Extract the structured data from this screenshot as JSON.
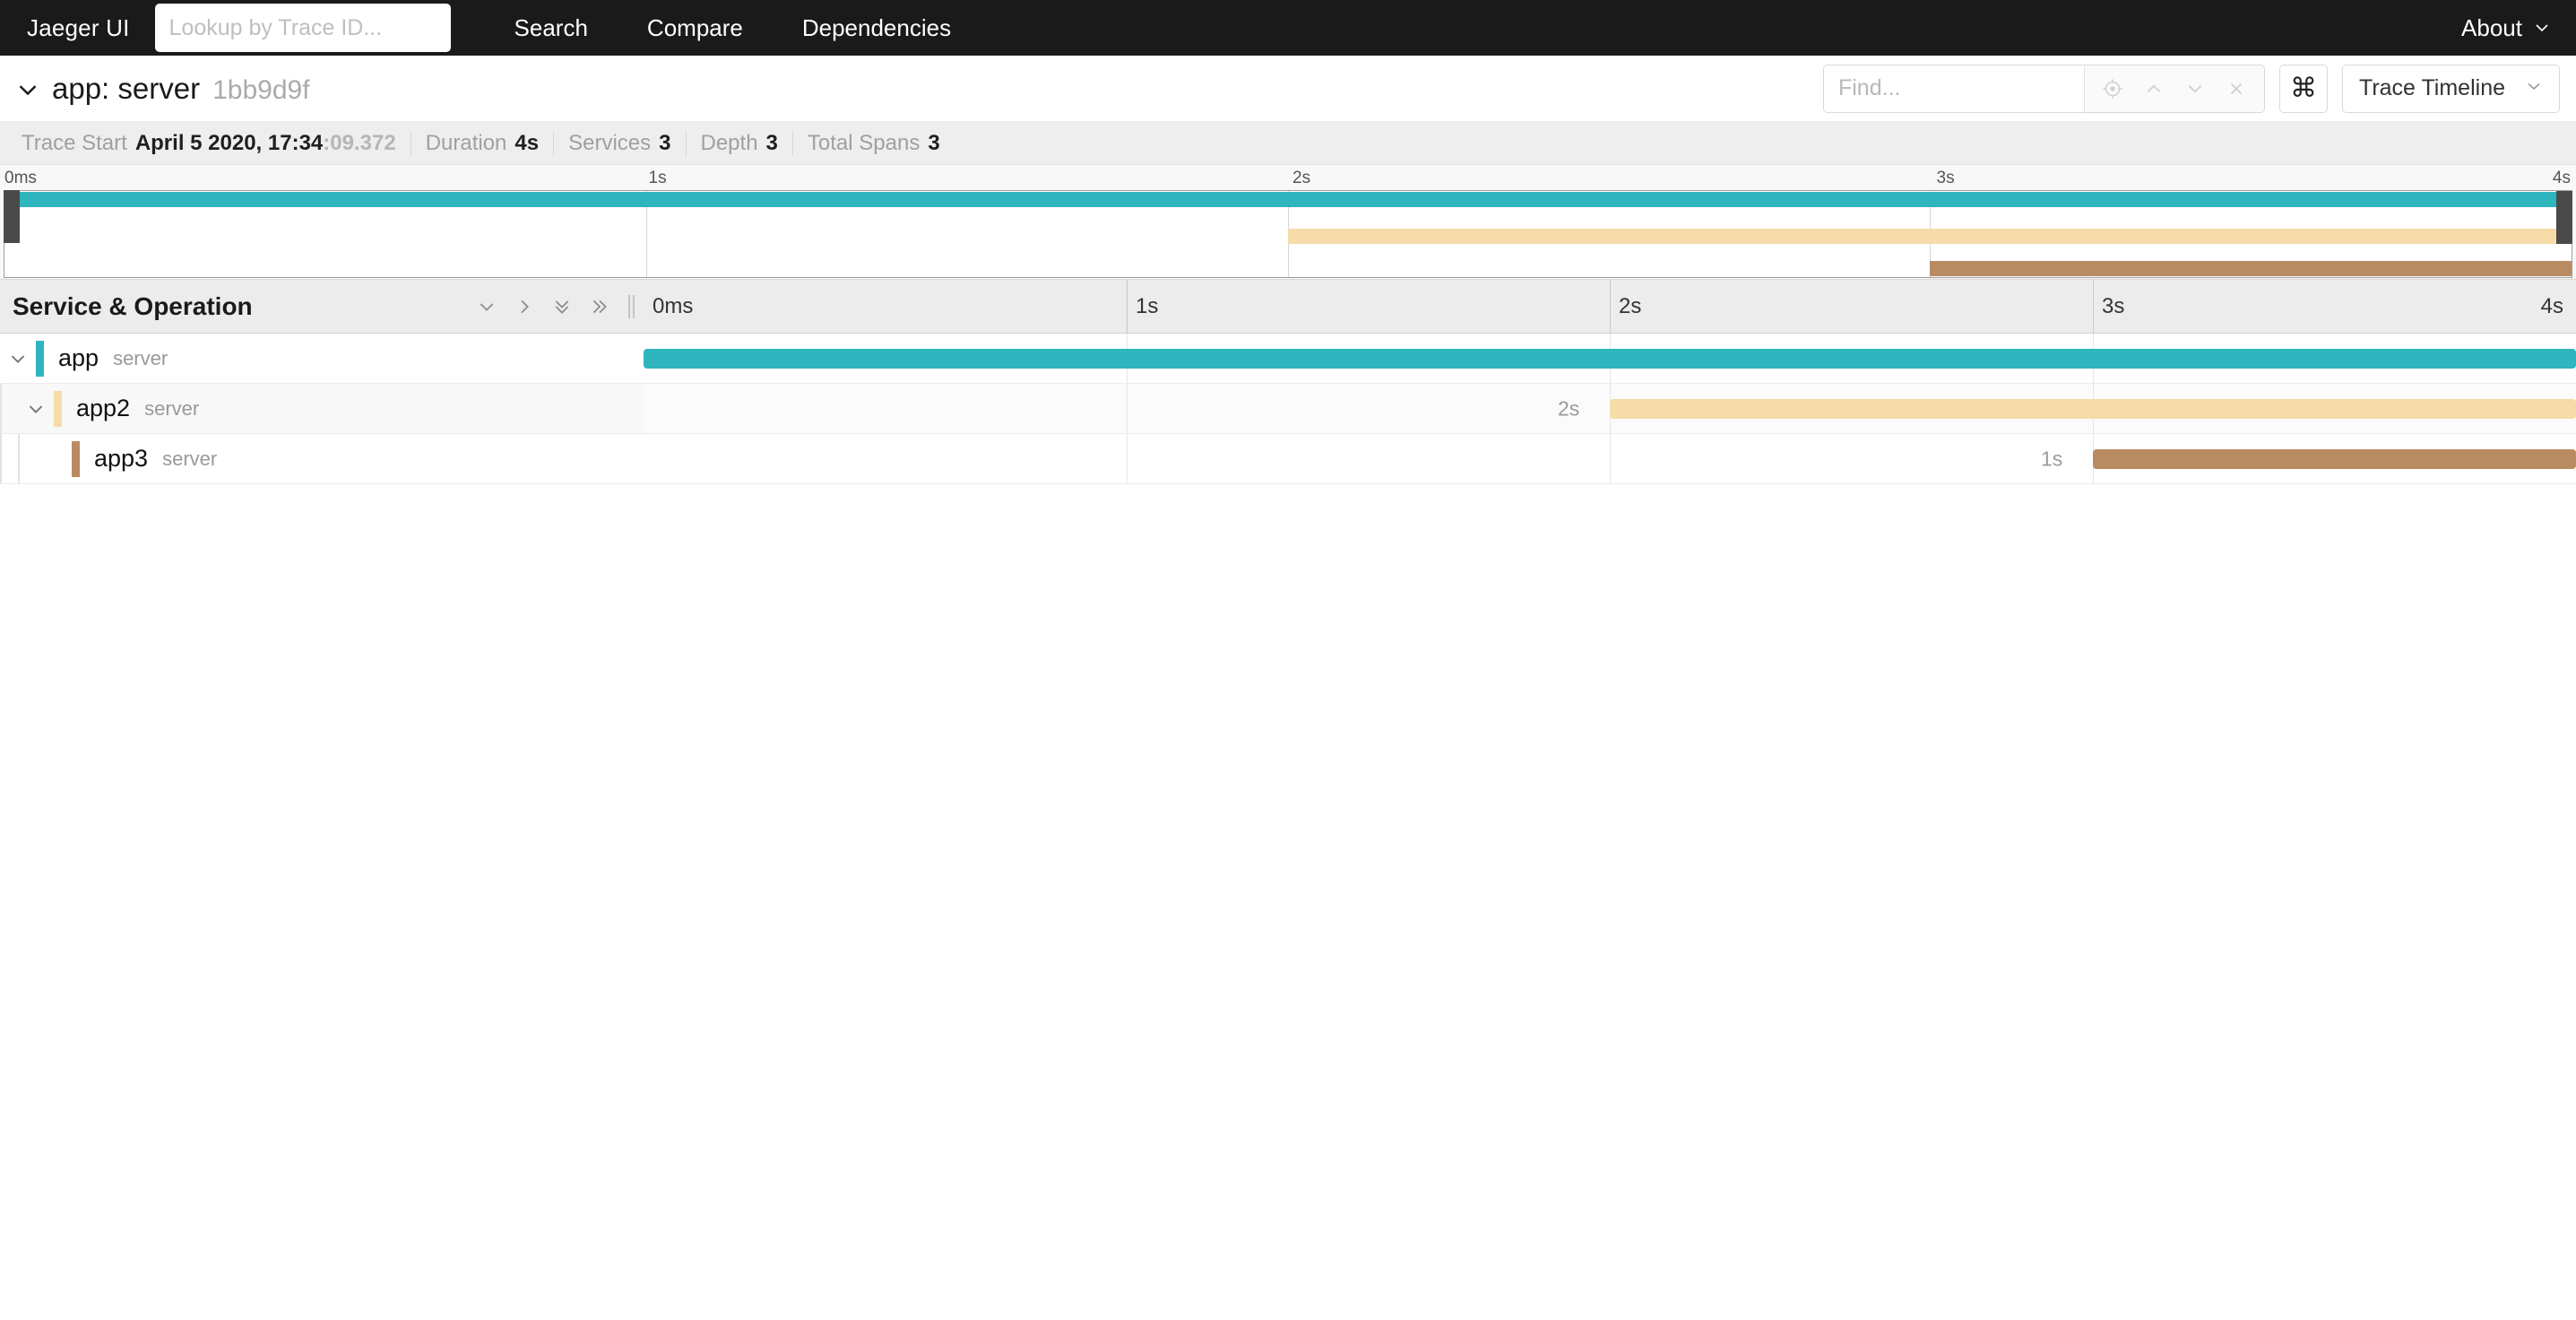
{
  "topnav": {
    "brand": "Jaeger UI",
    "trace_lookup_placeholder": "Lookup by Trace ID...",
    "trace_lookup_value": "",
    "links": [
      {
        "label": "Search"
      },
      {
        "label": "Compare"
      },
      {
        "label": "Dependencies"
      }
    ],
    "about_label": "About",
    "about_caret_icon": "chevron-down-icon"
  },
  "trace_header": {
    "collapse_icon": "chevron-down-icon",
    "title": "app: server",
    "trace_id": "1bb9d9f",
    "find": {
      "placeholder": "Find...",
      "value": "",
      "buttons": [
        {
          "icon": "focus-target-icon",
          "glyph": "◎"
        },
        {
          "icon": "chevron-up-icon",
          "glyph": "∧"
        },
        {
          "icon": "chevron-down-icon",
          "glyph": "∨"
        },
        {
          "icon": "close-icon",
          "glyph": "✕"
        }
      ]
    },
    "keyboard_shortcuts_icon": "command-key-icon",
    "keyboard_shortcuts_glyph": "⌘",
    "view_select_label": "Trace Timeline",
    "view_select_caret_icon": "chevron-down-icon"
  },
  "trace_meta": [
    {
      "label": "Trace Start",
      "value": "April 5 2020, 17:34",
      "value_dim": ":09.372"
    },
    {
      "label": "Duration",
      "value": "4s",
      "value_dim": ""
    },
    {
      "label": "Services",
      "value": "3",
      "value_dim": ""
    },
    {
      "label": "Depth",
      "value": "3",
      "value_dim": ""
    },
    {
      "label": "Total Spans",
      "value": "3",
      "value_dim": ""
    }
  ],
  "minimap": {
    "ticks": [
      "0ms",
      "1s",
      "2s",
      "3s",
      "4s"
    ],
    "left_handle_name": "minimap-drag-handle-left",
    "right_handle_name": "minimap-drag-handle-right"
  },
  "timeline_header": {
    "column_title": "Service & Operation",
    "collapse_controls": [
      {
        "icon": "chevron-down-icon",
        "glyph": "∨",
        "name": "expand-one-level-button"
      },
      {
        "icon": "chevron-right-icon",
        "glyph": "›",
        "name": "collapse-one-level-button"
      },
      {
        "icon": "double-chevron-down-icon",
        "glyph": "⌄⌄",
        "name": "expand-all-button"
      },
      {
        "icon": "double-chevron-right-icon",
        "glyph": "»",
        "name": "collapse-all-button"
      }
    ],
    "ticks": [
      "0ms",
      "1s",
      "2s",
      "3s",
      "4s"
    ]
  },
  "chart_data": {
    "type": "bar",
    "title": "Trace Timeline",
    "xlabel": "",
    "ylabel": "",
    "xlim": [
      0,
      4
    ],
    "x_tick_labels": [
      "0ms",
      "1s",
      "2s",
      "3s",
      "4s"
    ],
    "x_tick_values": [
      0,
      1,
      2,
      3,
      4
    ],
    "grid": true,
    "legend": "none",
    "categories": [
      "app",
      "app2",
      "app3"
    ],
    "series": [
      {
        "name": "span-durations",
        "values": [
          4,
          2,
          1
        ],
        "starts": [
          0,
          2,
          3
        ],
        "colors": [
          "#2eb5bd",
          "#f5dca8",
          "#b98b63"
        ]
      }
    ]
  },
  "spans": [
    {
      "service": "app",
      "operation": "server",
      "depth": 0,
      "has_children": true,
      "toggle_icon": "chevron-down-icon",
      "toggle_glyph": "∨",
      "color": "#2eb5bd",
      "start_s": 0,
      "duration_s": 4,
      "duration_label": "",
      "shaded": false
    },
    {
      "service": "app2",
      "operation": "server",
      "depth": 1,
      "has_children": true,
      "toggle_icon": "chevron-down-icon",
      "toggle_glyph": "∨",
      "color": "#f5dca8",
      "start_s": 2,
      "duration_s": 2,
      "duration_label": "2s",
      "shaded": true
    },
    {
      "service": "app3",
      "operation": "server",
      "depth": 2,
      "has_children": false,
      "toggle_icon": "",
      "toggle_glyph": "",
      "color": "#b98b63",
      "start_s": 3,
      "duration_s": 1,
      "duration_label": "1s",
      "shaded": false
    }
  ],
  "colors": {
    "navbar_bg": "#1a1a1a",
    "meta_bg": "#eeeeee",
    "timeline_header_bg": "#ececec",
    "span_app": "#2eb5bd",
    "span_app2": "#f5dca8",
    "span_app3": "#b98b63"
  }
}
